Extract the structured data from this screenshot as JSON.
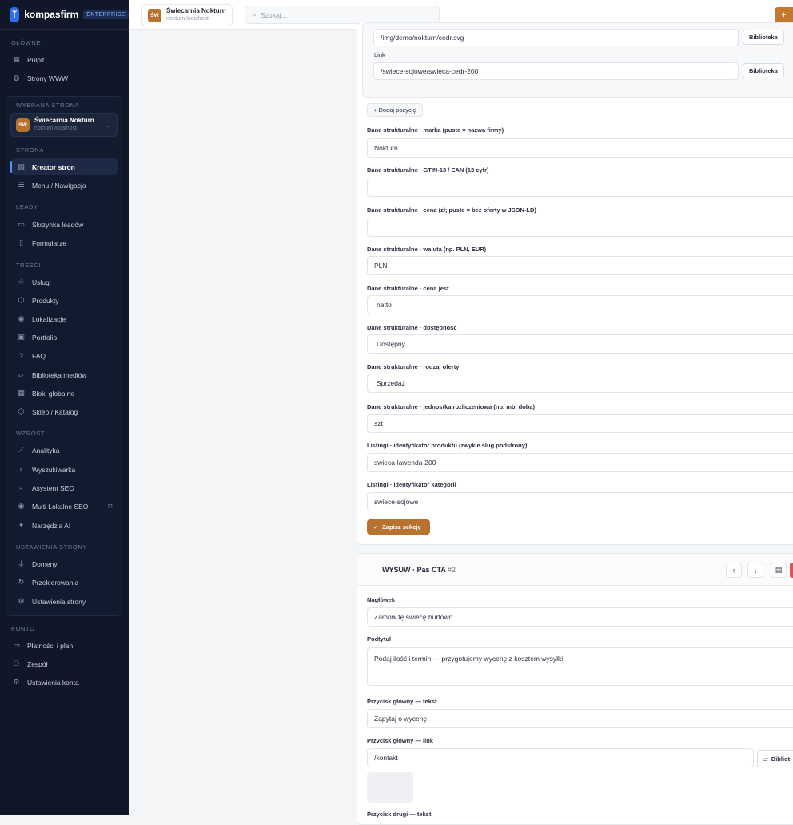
{
  "brand": {
    "name": "kompasfirm",
    "badge": "ENTERPRISE"
  },
  "sidebar": {
    "section_main": "GŁÓWNE",
    "main_items": [
      "Pulpit",
      "Strony WWW"
    ],
    "selected_site_title": "WYBRANA STRONA",
    "site": {
      "initials": "ŚW",
      "name": "Świecarnia Nokturn",
      "host": "nokturn.localhost"
    },
    "section_site": "STRONA",
    "site_items": [
      "Kreator stron",
      "Menu / Nawigacja"
    ],
    "section_leads": "LEADY",
    "lead_items": [
      "Skrzynka leadów",
      "Formularze"
    ],
    "section_content": "TREŚCI",
    "content_items": [
      "Usługi",
      "Produkty",
      "Lokalizacje",
      "Portfolio",
      "FAQ",
      "Biblioteka mediów",
      "Bloki globalne",
      "Sklep / Katalog"
    ],
    "section_growth": "WZROST",
    "growth_items": [
      "Analityka",
      "Wyszukiwarka",
      "Asystent SEO",
      "Multi Lokalne SEO",
      "Narzędzia AI"
    ],
    "section_site_settings": "USTAWIENIA STRONY",
    "site_settings_items": [
      "Domeny",
      "Przekierowania",
      "Ustawienia strony"
    ],
    "section_account": "KONTO",
    "account_items": [
      "Płatności i plan",
      "Zespół",
      "Ustawienia konta"
    ]
  },
  "topbar": {
    "site_initials": "ŚW",
    "site_name": "Świecarnia Nokturn",
    "site_host": "nokturn.localhost",
    "search_placeholder": "Szukaj..."
  },
  "editor": {
    "image_value": "/img/demo/nokturn/cedr.svg",
    "library_label": "Biblioteka",
    "link_label": "Link",
    "link_value": "/swiece-sojowe/swieca-cedr-200",
    "add_position": "+ Dodaj pozycję",
    "fields": [
      {
        "label": "Dane strukturalne · marka (puste = nazwa firmy)",
        "value": "Nokturn"
      },
      {
        "label": "Dane strukturalne · GTIN-13 / EAN (13 cyfr)",
        "value": ""
      },
      {
        "label": "Dane strukturalne · cena (zł; puste = bez oferty w JSON-LD)",
        "value": ""
      },
      {
        "label": "Dane strukturalne · waluta (np. PLN, EUR)",
        "value": "PLN"
      },
      {
        "label": "Dane strukturalne · cena jest",
        "value": "netto"
      },
      {
        "label": "Dane strukturalne · dostępność",
        "value": "Dostępny"
      },
      {
        "label": "Dane strukturalne · rodzaj oferty",
        "value": "Sprzedaż"
      },
      {
        "label": "Dane strukturalne · jednostka rozliczeniowa (np. mb, doba)",
        "value": "szt"
      },
      {
        "label": "Listingi · identyfikator produktu (zwykle slug podstrony)",
        "value": "swieca-lawenda-200"
      },
      {
        "label": "Listingi · identyfikator kategorii",
        "value": "swiece-sojowe"
      }
    ],
    "save_label": "Zapisz sekcję"
  },
  "cta": {
    "title": "WYSUW · Pas CTA",
    "number": "#2",
    "heading_label": "Nagłówek",
    "heading_value": "Zamów tę świecę hurtowo",
    "subtitle_label": "Podtytuł",
    "subtitle_value": "Podaj ilość i termin — przygotujemy wycenę z kosztem wysyłki.",
    "primary_text_label": "Przycisk główny — tekst",
    "primary_text_value": "Zapytaj o wycenę",
    "primary_link_label": "Przycisk główny — link",
    "primary_link_value": "/kontakt",
    "library_label": "Bibliot",
    "secondary_label": "Przycisk drugi — tekst"
  }
}
